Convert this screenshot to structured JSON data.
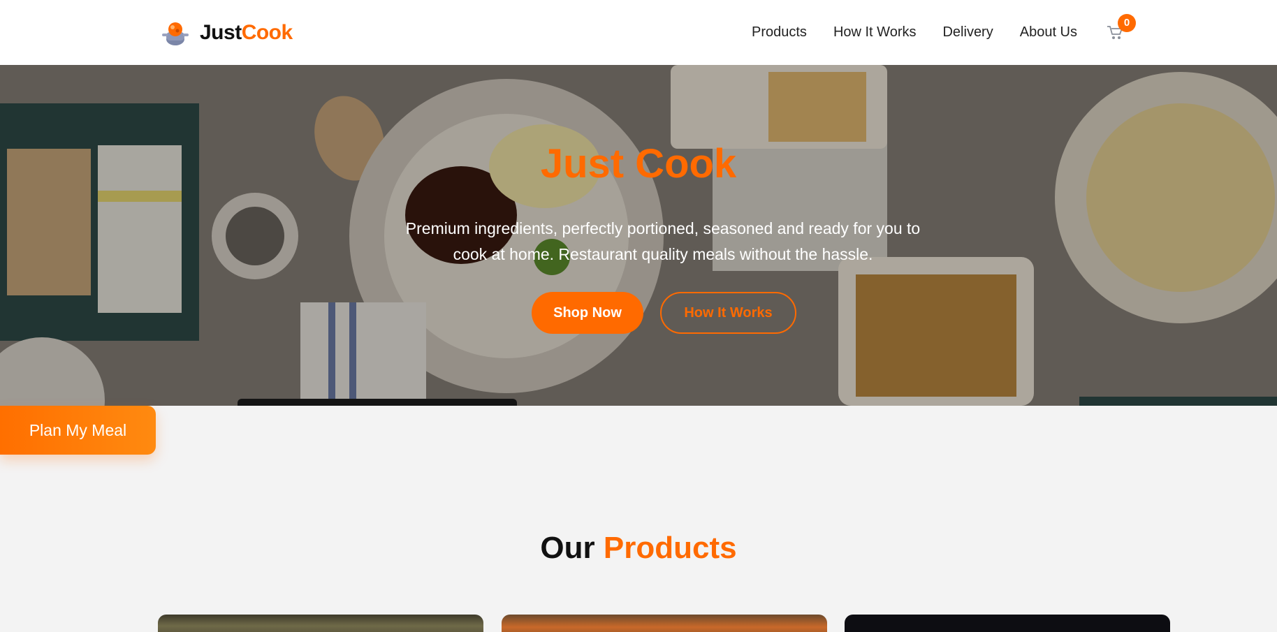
{
  "brand": {
    "name_part1": "Just",
    "name_part2": "Cook"
  },
  "nav": {
    "items": [
      {
        "label": "Products"
      },
      {
        "label": "How It Works"
      },
      {
        "label": "Delivery"
      },
      {
        "label": "About Us"
      }
    ],
    "cart_count": "0"
  },
  "hero": {
    "title": "Just Cook",
    "subtitle": "Premium ingredients, perfectly portioned, seasoned and ready for you to cook at home. Restaurant quality meals without the hassle.",
    "primary_button": "Shop Now",
    "secondary_button": "How It Works"
  },
  "floating_cta": {
    "label": "Plan My Meal"
  },
  "products_section": {
    "title_part1": "Our",
    "title_part2": "Products"
  },
  "colors": {
    "accent": "#ff6a00",
    "text": "#111111",
    "page_bg": "#f3f3f3"
  },
  "icons": {
    "logo": "cooking-pot-icon",
    "cart": "shopping-cart-icon"
  }
}
